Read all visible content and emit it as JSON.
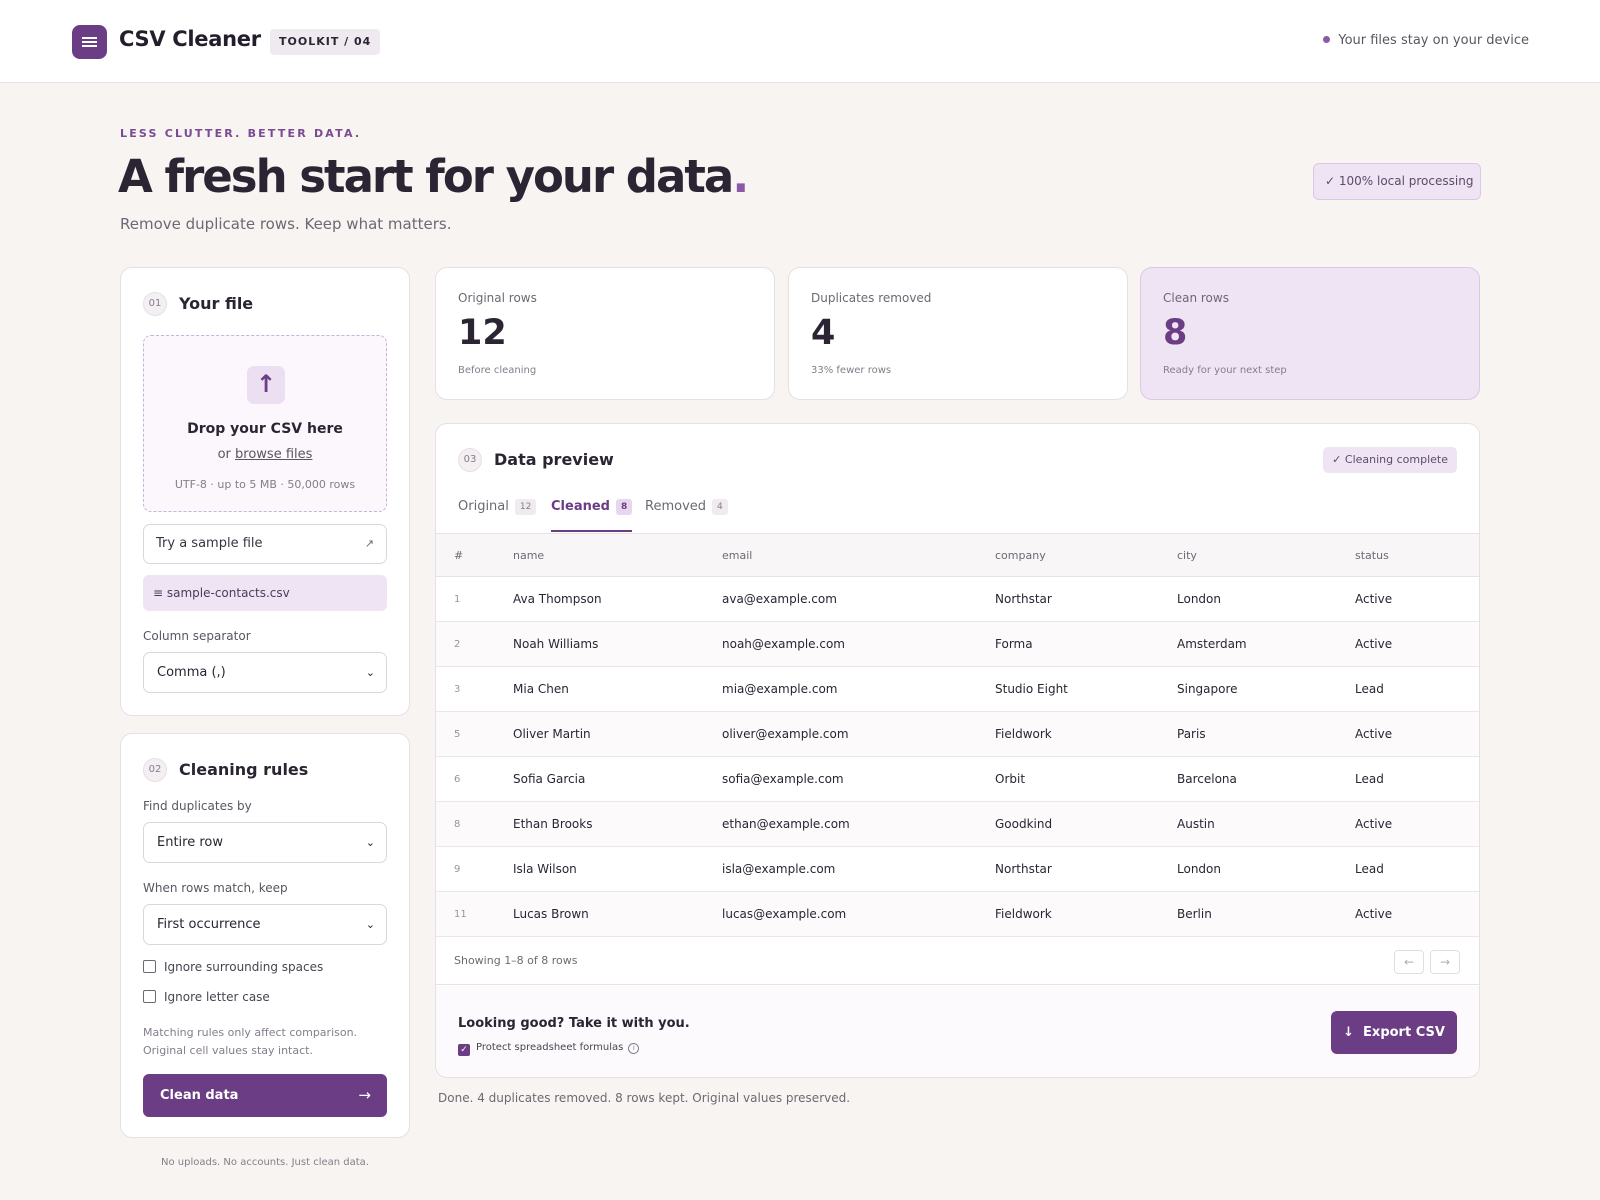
{
  "header": {
    "brand": "CSV Cleaner",
    "toolkit_badge": "TOOLKIT / 04",
    "privacy_note": "Your files stay on your device"
  },
  "hero": {
    "eyebrow": "LESS CLUTTER. BETTER DATA.",
    "title": "A fresh start for your data",
    "title_accent": ".",
    "subtitle": "Remove duplicate rows. Keep what matters.",
    "local_badge": "✓  100% local processing"
  },
  "file_panel": {
    "step": "01",
    "title": "Your file",
    "drop_title": "Drop your CSV here",
    "drop_or": "or",
    "browse_link": "browse files",
    "drop_meta": "UTF-8 · up to 5 MB · 50,000 rows",
    "sample_button": "Try a sample file",
    "sample_arrow": "↗",
    "loaded_file": "≡ sample-contacts.csv",
    "separator_label": "Column separator",
    "separator_value": "Comma (,)"
  },
  "rules_panel": {
    "step": "02",
    "title": "Cleaning rules",
    "find_label": "Find duplicates by",
    "find_value": "Entire row",
    "keep_label": "When rows match, keep",
    "keep_value": "First occurrence",
    "ignore_spaces": "Ignore surrounding spaces",
    "ignore_case": "Ignore letter case",
    "hint": "Matching rules only affect comparison. Original cell values stay intact.",
    "clean_button": "Clean data",
    "clean_arrow": "→"
  },
  "footnote": "No uploads. No accounts. Just clean data.",
  "stats": [
    {
      "label": "Original rows",
      "value": "12",
      "sub": "Before cleaning"
    },
    {
      "label": "Duplicates removed",
      "value": "4",
      "sub": "33% fewer rows"
    },
    {
      "label": "Clean rows",
      "value": "8",
      "sub": "Ready for your next step"
    }
  ],
  "preview": {
    "step": "03",
    "title": "Data preview",
    "status_badge": "✓ Cleaning complete",
    "tabs": [
      {
        "label": "Original",
        "count": "12"
      },
      {
        "label": "Cleaned",
        "count": "8"
      },
      {
        "label": "Removed",
        "count": "4"
      }
    ],
    "active_tab": "Cleaned",
    "columns": [
      "#",
      "name",
      "email",
      "company",
      "city",
      "status"
    ],
    "rows": [
      [
        "1",
        "Ava Thompson",
        "ava@example.com",
        "Northstar",
        "London",
        "Active"
      ],
      [
        "2",
        "Noah Williams",
        "noah@example.com",
        "Forma",
        "Amsterdam",
        "Active"
      ],
      [
        "3",
        "Mia Chen",
        "mia@example.com",
        "Studio Eight",
        "Singapore",
        "Lead"
      ],
      [
        "5",
        "Oliver Martin",
        "oliver@example.com",
        "Fieldwork",
        "Paris",
        "Active"
      ],
      [
        "6",
        "Sofia Garcia",
        "sofia@example.com",
        "Orbit",
        "Barcelona",
        "Lead"
      ],
      [
        "8",
        "Ethan Brooks",
        "ethan@example.com",
        "Goodkind",
        "Austin",
        "Active"
      ],
      [
        "9",
        "Isla Wilson",
        "isla@example.com",
        "Northstar",
        "London",
        "Lead"
      ],
      [
        "11",
        "Lucas Brown",
        "lucas@example.com",
        "Fieldwork",
        "Berlin",
        "Active"
      ]
    ],
    "showing": "Showing 1–8 of 8 rows",
    "prev": "←",
    "next": "→",
    "export_title": "Looking good? Take it with you.",
    "protect_label": "Protect spreadsheet formulas",
    "export_button": "Export CSV"
  },
  "status_line": "Done. 4 duplicates removed. 8 rows kept. Original values preserved.",
  "colors": {
    "accent": "#6b3d84",
    "accent_light": "#efe4f3",
    "background": "#f7f4f2"
  }
}
